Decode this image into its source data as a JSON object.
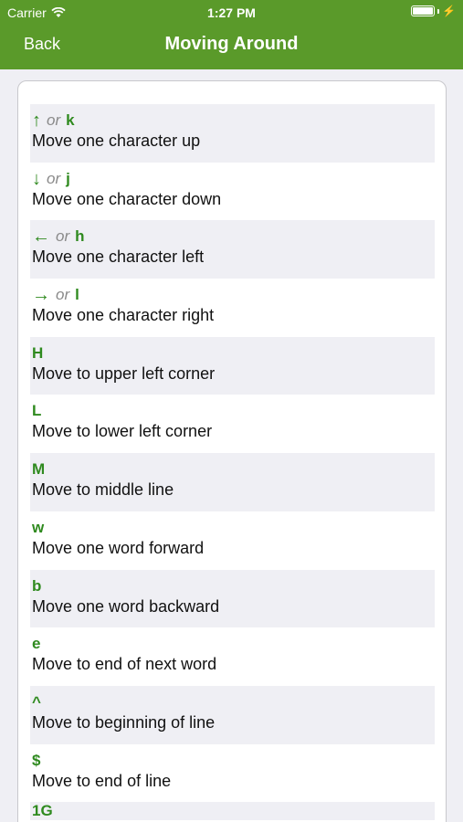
{
  "status_bar": {
    "carrier": "Carrier",
    "time": "1:27 PM"
  },
  "nav": {
    "back_label": "Back",
    "title": "Moving Around"
  },
  "or_label": "or",
  "commands": [
    {
      "key": "↑",
      "alt_key": "k",
      "description": "Move one character up"
    },
    {
      "key": "↓",
      "alt_key": "j",
      "description": "Move one character down"
    },
    {
      "key": "←",
      "alt_key": "h",
      "description": "Move one character left"
    },
    {
      "key": "→",
      "alt_key": "l",
      "description": "Move one character right"
    },
    {
      "key": "H",
      "description": "Move to upper left corner"
    },
    {
      "key": "L",
      "description": "Move to lower left corner"
    },
    {
      "key": "M",
      "description": "Move to middle line"
    },
    {
      "key": "w",
      "description": "Move one word forward"
    },
    {
      "key": "b",
      "description": "Move one word backward"
    },
    {
      "key": "e",
      "description": "Move to end of next word"
    },
    {
      "key": "^",
      "description": "Move to beginning of line"
    },
    {
      "key": "$",
      "description": "Move to end of line"
    }
  ],
  "partial_row_key": "1G",
  "colors": {
    "header": "#5a9a2a",
    "key": "#2f8a1f",
    "shade": "#efeff4"
  }
}
